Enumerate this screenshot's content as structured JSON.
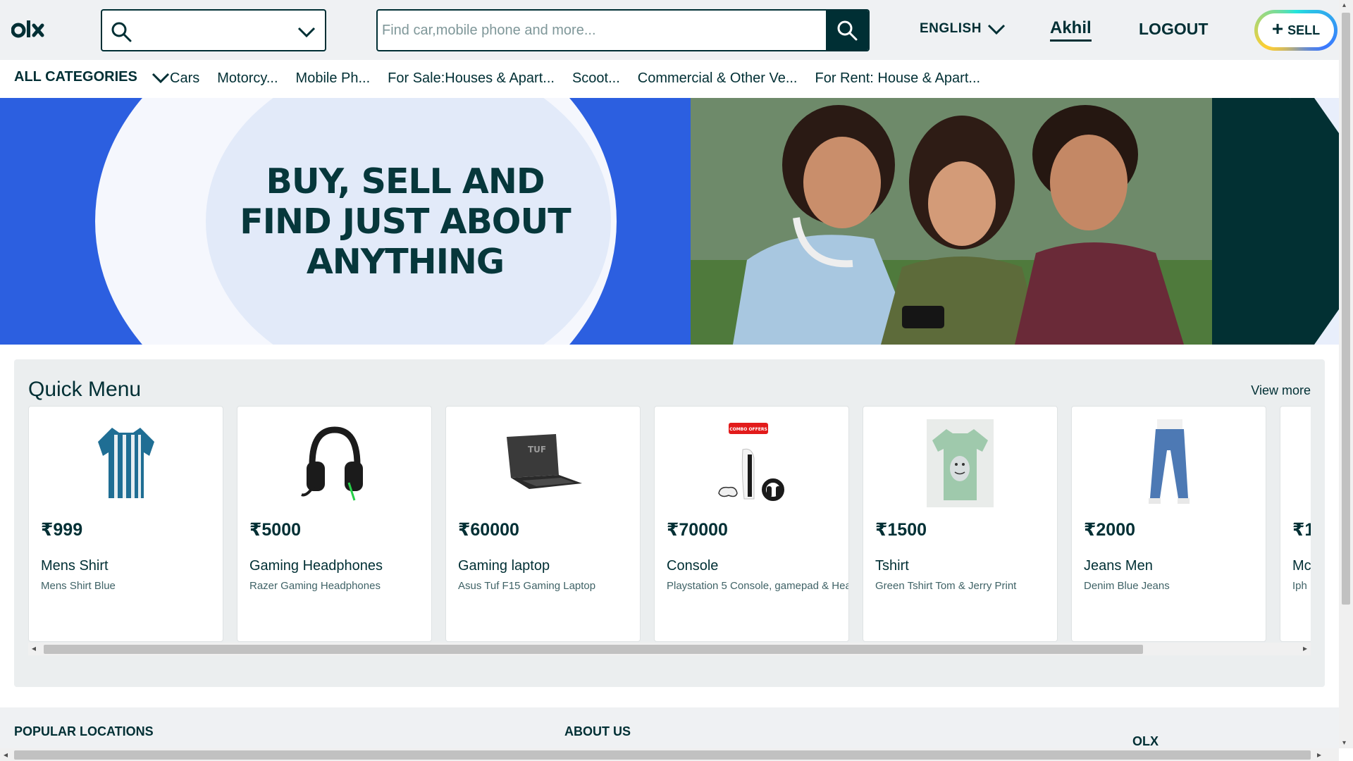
{
  "header": {
    "logo_text": "olx",
    "location_icon": "search-icon",
    "search_placeholder": "Find car,mobile phone and more...",
    "language": "ENGLISH",
    "user_name": "Akhil",
    "logout_label": "LOGOUT",
    "sell_label": "SELL"
  },
  "categories": {
    "all_label": "ALL CATEGORIES",
    "items": [
      "Cars",
      "Motorcy...",
      "Mobile Ph...",
      "For Sale:Houses & Apart...",
      "Scoot...",
      "Commercial & Other Ve...",
      "For Rent: House & Apart..."
    ]
  },
  "banner": {
    "line1": "BUY, SELL AND",
    "line2": "FIND JUST ABOUT",
    "line3": "ANYTHING",
    "colors": {
      "blue": "#2c5fe0",
      "dark_teal": "#023033",
      "text": "#06373b"
    }
  },
  "quick_menu": {
    "title": "Quick Menu",
    "view_more": "View more",
    "cards": [
      {
        "price": "₹999",
        "title": "Mens Shirt",
        "desc": "Mens Shirt Blue",
        "icon": "shirt-icon"
      },
      {
        "price": "₹5000",
        "title": "Gaming Headphones",
        "desc": "Razer Gaming Headphones",
        "icon": "headphones-icon"
      },
      {
        "price": "₹60000",
        "title": "Gaming laptop",
        "desc": "Asus Tuf F15 Gaming Laptop",
        "icon": "laptop-icon"
      },
      {
        "price": "₹70000",
        "title": "Console",
        "desc": "Playstation 5 Console, gamepad & Hea",
        "icon": "console-icon",
        "badge": "COMBO OFFERS"
      },
      {
        "price": "₹1500",
        "title": "Tshirt",
        "desc": "Green Tshirt Tom & Jerry Print",
        "icon": "tshirt-icon"
      },
      {
        "price": "₹2000",
        "title": "Jeans Men",
        "desc": "Denim Blue Jeans",
        "icon": "jeans-icon"
      },
      {
        "price": "₹1",
        "title": "Mc",
        "desc": "Iph",
        "icon": "phone-icon"
      }
    ]
  },
  "footer": {
    "popular_locations": "POPULAR LOCATIONS",
    "about_us": "ABOUT US",
    "olx": "OLX"
  }
}
